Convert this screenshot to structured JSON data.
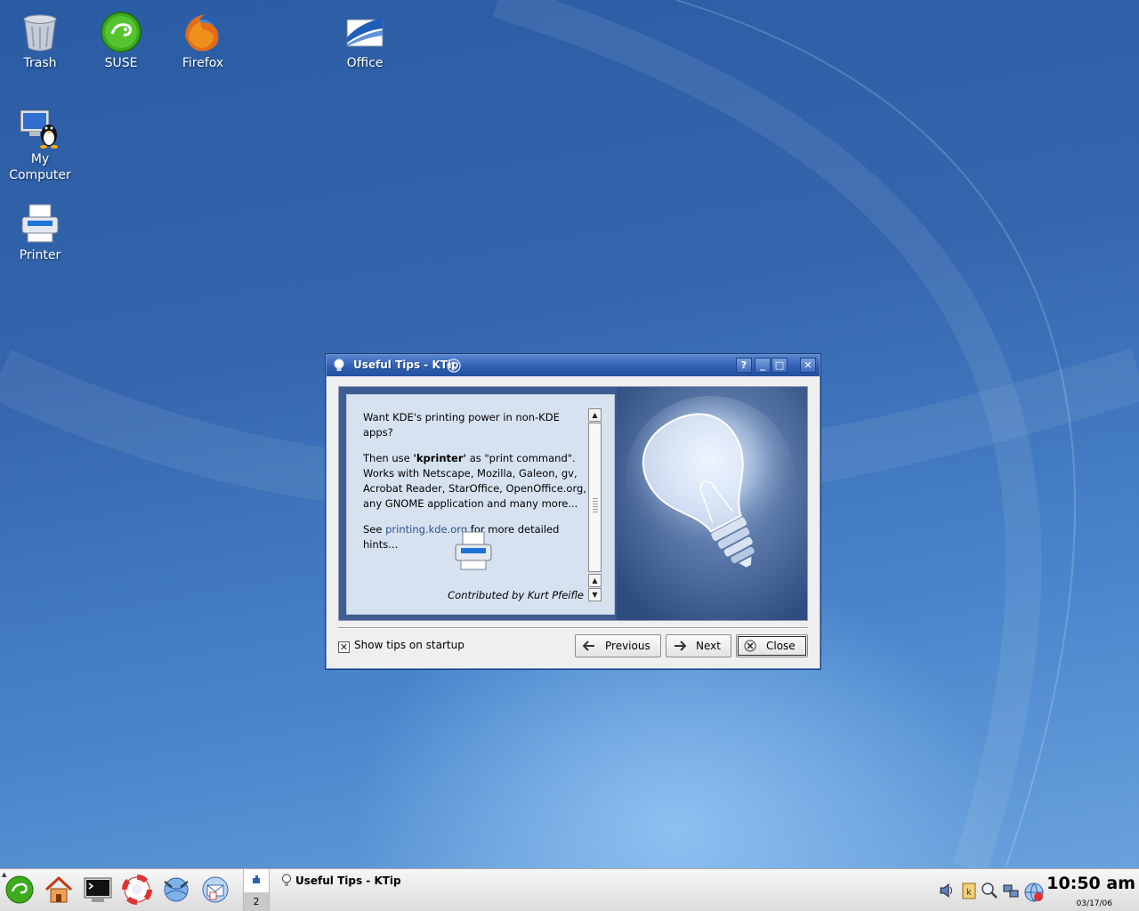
{
  "desktop": {
    "icons": [
      {
        "label": "Trash",
        "icon": "trash-icon"
      },
      {
        "label": "SUSE",
        "icon": "suse-icon"
      },
      {
        "label": "Firefox",
        "icon": "firefox-icon"
      },
      {
        "label": "Office",
        "icon": "office-icon"
      },
      {
        "label_line1": "My",
        "label_line2": "Computer",
        "icon": "my-computer-icon"
      },
      {
        "label": "Printer",
        "icon": "printer-icon"
      }
    ]
  },
  "dialog": {
    "title": "Useful Tips - KTip",
    "title_buttons": {
      "help": "?",
      "minimize": "_",
      "maximize": "□",
      "close": "✕"
    },
    "tip": {
      "line1": "Want KDE's printing power in non-KDE apps?",
      "para2_prefix": "Then use ",
      "para2_bold": "'kprinter'",
      "para2_rest": " as \"print command\". Works with Netscape, Mozilla, Galeon, gv, Acrobat Reader, StarOffice, OpenOffice.org, any GNOME application and many more...",
      "para3_prefix": "See ",
      "para3_link": "printing.kde.org",
      "para3_rest": " for more detailed hints...",
      "credit": "Contributed by Kurt Pfeifle"
    },
    "show_tips_label": "Show tips on startup",
    "show_tips_checked": true,
    "buttons": {
      "previous": "Previous",
      "next": "Next",
      "close": "Close"
    }
  },
  "taskbar": {
    "pager": {
      "desktop2": "2"
    },
    "task_title": "Useful Tips - KTip",
    "clock": "10:50 am",
    "date": "03/17/06"
  },
  "colors": {
    "accent": "#2f5fb3",
    "desktop": "#3465ad"
  }
}
